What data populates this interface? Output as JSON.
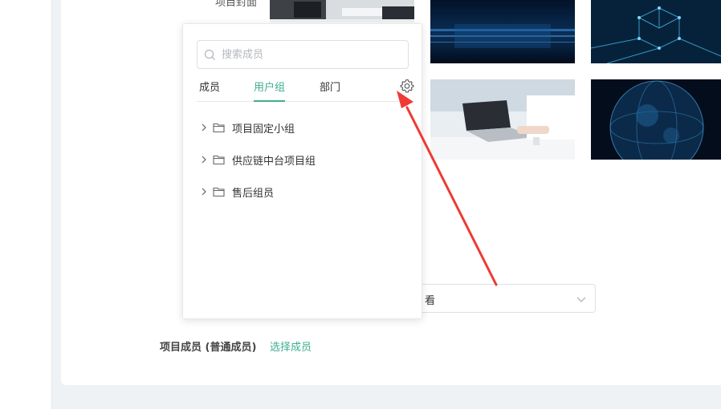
{
  "page": {
    "cover_label": "项目封面",
    "members_label": "项目成员 (普通成员)",
    "members_link": "选择成员"
  },
  "select": {
    "value": "看"
  },
  "popover": {
    "search_placeholder": "搜索成员",
    "tabs": [
      {
        "label": "成员",
        "active": false
      },
      {
        "label": "用户组",
        "active": true
      },
      {
        "label": "部门",
        "active": false
      }
    ],
    "groups": [
      {
        "label": "项目固定小组"
      },
      {
        "label": "供应链中台项目组"
      },
      {
        "label": "售后组员"
      }
    ]
  },
  "colors": {
    "accent": "#3fae8f",
    "annotation_arrow": "#f03a33"
  },
  "icons": [
    "search-icon",
    "gear-icon",
    "chevron-right-icon",
    "folder-icon",
    "chevron-down-icon"
  ]
}
